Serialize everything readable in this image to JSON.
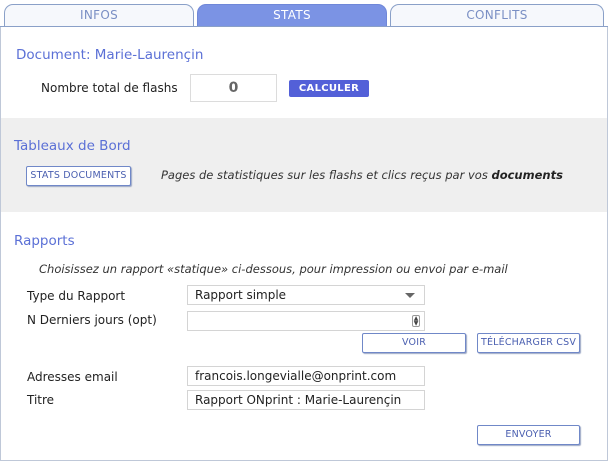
{
  "tabs": [
    {
      "label": "INFOS",
      "active": false
    },
    {
      "label": "STATS",
      "active": true
    },
    {
      "label": "CONFLITS",
      "active": false
    }
  ],
  "document_section": {
    "title": "Document: Marie-Laurençin",
    "total_flashes_label": "Nombre total de flashs",
    "total_flashes_value": "0",
    "calculate_button": "CALCULER"
  },
  "dashboards": {
    "title": "Tableaux de Bord",
    "button": "STATS DOCUMENTS",
    "description_prefix": "Pages de statistiques sur les flashs et clics reçus par vos ",
    "description_bold": "documents"
  },
  "reports": {
    "title": "Rapports",
    "instructions": "Choisissez un rapport «statique» ci-dessous, pour impression ou envoi par e-mail",
    "report_type_label": "Type du Rapport",
    "report_type_value": "Rapport simple",
    "last_days_label": "N Derniers jours (opt)",
    "last_days_value": "",
    "view_button": "VOIR",
    "download_button": "TÉLÉCHARGER CSV",
    "email_label": "Adresses email",
    "email_value": "francois.longevialle@onprint.com",
    "title_label": "Titre",
    "title_value": "Rapport ONprint : Marie-Laurençin",
    "send_button": "ENVOYER"
  },
  "colors": {
    "accent": "#5b70d6",
    "active_tab": "#7b93e4",
    "primary_button": "#5360d8",
    "gray_section": "#efefef"
  }
}
